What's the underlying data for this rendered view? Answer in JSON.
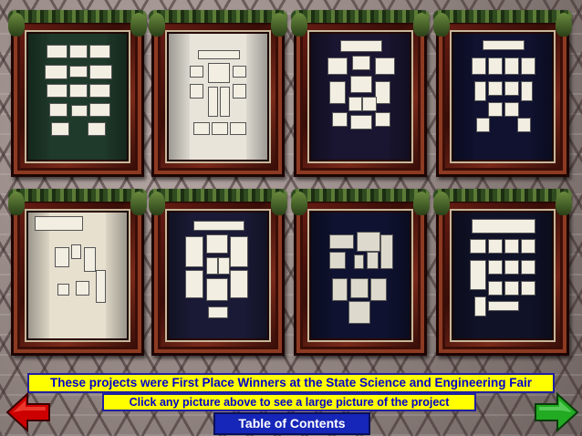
{
  "projects": [
    {
      "id": "project-1",
      "bg": "#1f3a2a",
      "panel_tone": "light"
    },
    {
      "id": "project-2",
      "bg": "#e8e4da",
      "panel_tone": "light"
    },
    {
      "id": "project-3",
      "bg": "#1a1530",
      "panel_tone": "light"
    },
    {
      "id": "project-4",
      "bg": "#101230",
      "panel_tone": "light"
    },
    {
      "id": "project-5",
      "bg": "#e7e0cf",
      "panel_tone": "light"
    },
    {
      "id": "project-6",
      "bg": "#1a1a36",
      "panel_tone": "light"
    },
    {
      "id": "project-7",
      "bg": "#0f1230",
      "panel_tone": "dark"
    },
    {
      "id": "project-8",
      "bg": "#101228",
      "panel_tone": "light"
    }
  ],
  "caption_main": "These projects were First Place Winners at the State Science and Engineering Fair",
  "caption_sub": "Click any picture above to see a large picture of the project",
  "toc_label": "Table of Contents",
  "nav": {
    "back_icon": "left-arrow",
    "back_color": "#cc0000",
    "next_icon": "right-arrow",
    "next_color": "#22aa22"
  },
  "colors": {
    "caption_bg": "#ffff00",
    "caption_text": "#0000cc",
    "toc_bg": "#1626b8"
  }
}
